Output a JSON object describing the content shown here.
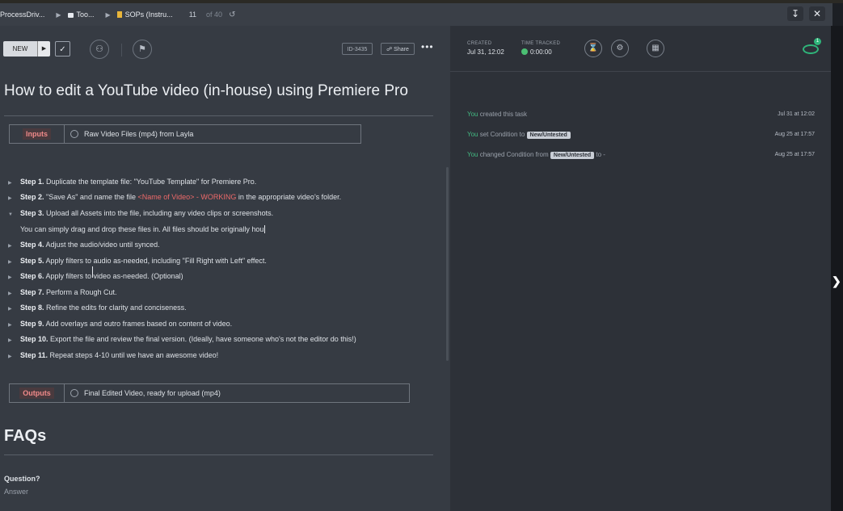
{
  "breadcrumb": {
    "workspace": "ProcessDriv...",
    "space": "Too...",
    "list": "SOPs (Instru...",
    "position": "11",
    "of_total": "of 40"
  },
  "toolbar": {
    "status_label": "NEW",
    "task_id": "ID-3435",
    "share_label": "Share"
  },
  "task": {
    "title": "How to edit a YouTube video (in-house) using Premiere Pro",
    "inputs_label": "Inputs",
    "inputs_text": "Raw Video Files (mp4) from Layla",
    "outputs_label": "Outputs",
    "outputs_text": "Final Edited Video, ready for upload (mp4)",
    "steps": [
      {
        "label": "Step 1.",
        "pre": " Duplicate the template file: \"YouTube Template\" for Premiere Pro.",
        "highlight": "",
        "post": ""
      },
      {
        "label": "Step 2.",
        "pre": " \"Save As\" and name the file ",
        "highlight": " <Name of Video> - WORKING ",
        "post": " in the appropriate video's folder."
      },
      {
        "label": "Step 3.",
        "pre": " Upload all Assets into the file, including any video clips or screenshots.",
        "highlight": "",
        "post": ""
      },
      {
        "label": "",
        "pre": "You can simply drag and drop these files in. All files should be originally hou",
        "highlight": "",
        "post": ""
      },
      {
        "label": "Step 4.",
        "pre": " Adjust the audio/video until synced.",
        "highlight": "",
        "post": ""
      },
      {
        "label": "Step 5.",
        "pre": " Apply filters to audio as-needed, including \"Fill Right with Left\" effect.",
        "highlight": "",
        "post": ""
      },
      {
        "label": "Step 6.",
        "pre": " Apply filters to video as-needed. (Optional)",
        "highlight": "",
        "post": ""
      },
      {
        "label": "Step 7.",
        "pre": " Perform a Rough Cut.",
        "highlight": "",
        "post": ""
      },
      {
        "label": "Step 8.",
        "pre": " Refine the edits for clarity and conciseness.",
        "highlight": "",
        "post": ""
      },
      {
        "label": "Step 9.",
        "pre": " Add overlays and outro frames based on content of video.",
        "highlight": "",
        "post": ""
      },
      {
        "label": "Step 10.",
        "pre": " Export the file and review the final version. (Ideally, have someone who's not the editor do this!)",
        "highlight": "",
        "post": ""
      },
      {
        "label": "Step 11.",
        "pre": " Repeat steps 4-10 until we have an awesome video!",
        "highlight": "",
        "post": ""
      }
    ],
    "faq_heading": "FAQs",
    "faq_question": "Question?",
    "faq_answer": "Answer"
  },
  "sidebar": {
    "created_label": "CREATED",
    "created_value": "Jul 31, 12:02",
    "time_tracked_label": "TIME TRACKED",
    "time_tracked_value": "0:00:00",
    "watchers_count": "1",
    "activity": [
      {
        "actor": "You",
        "text": " created this task",
        "tag": "",
        "suffix": "",
        "date": "Jul 31 at 12:02"
      },
      {
        "actor": "You",
        "text": " set Condition to ",
        "tag": "New/Untested",
        "suffix": "",
        "date": "Aug 25 at 17:57"
      },
      {
        "actor": "You",
        "text": " changed Condition from ",
        "tag": "New/Untested",
        "suffix": " to -",
        "date": "Aug 25 at 17:57"
      }
    ]
  },
  "colors": {
    "accent_green": "#43b982",
    "input_label_red": "#f08a8a",
    "highlight_red": "#ee6a6a",
    "folder_yellow": "#e8b53a"
  }
}
